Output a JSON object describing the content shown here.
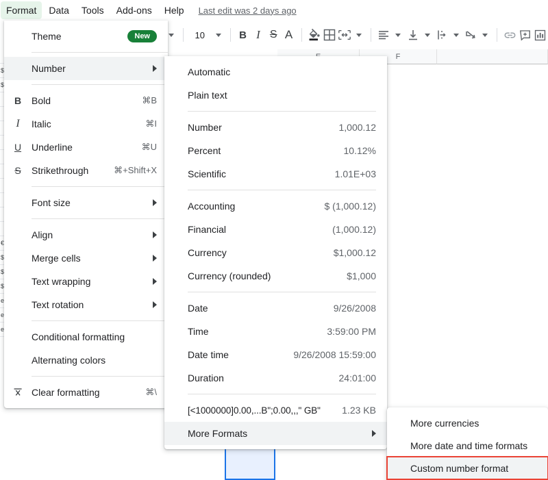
{
  "menubar": {
    "items": [
      {
        "label": "Format",
        "active": true
      },
      {
        "label": "Data",
        "active": false
      },
      {
        "label": "Tools",
        "active": false
      },
      {
        "label": "Add-ons",
        "active": false
      },
      {
        "label": "Help",
        "active": false
      }
    ],
    "last_edit": "Last edit was 2 days ago"
  },
  "toolbar": {
    "font_size": "10",
    "buttons": [
      {
        "name": "bold-button",
        "glyph": "B"
      },
      {
        "name": "italic-button",
        "glyph": "I"
      },
      {
        "name": "strikethrough-button",
        "glyph": "S"
      },
      {
        "name": "text-color-button",
        "glyph": "A"
      },
      {
        "name": "fill-color-icon",
        "glyph": ""
      },
      {
        "name": "borders-icon",
        "glyph": ""
      },
      {
        "name": "merge-cells-icon",
        "glyph": ""
      },
      {
        "name": "horizontal-align-icon",
        "glyph": ""
      },
      {
        "name": "vertical-align-icon",
        "glyph": ""
      },
      {
        "name": "text-wrapping-icon",
        "glyph": ""
      },
      {
        "name": "text-rotation-icon",
        "glyph": ""
      },
      {
        "name": "insert-link-icon",
        "glyph": ""
      },
      {
        "name": "insert-comment-icon",
        "glyph": ""
      },
      {
        "name": "insert-chart-icon",
        "glyph": ""
      }
    ]
  },
  "grid": {
    "column_headers": [
      "E",
      "F",
      ""
    ],
    "left_sliver": [
      "$",
      "$",
      "",
      "",
      "",
      "",
      "",
      "",
      "",
      "",
      "",
      "",
      "",
      "€",
      "$",
      "$",
      "$",
      "e",
      "e",
      "e",
      ""
    ]
  },
  "format_menu": {
    "items": [
      {
        "icon": "",
        "label": "Theme",
        "badge": "New",
        "type": "badge"
      },
      {
        "type": "separator"
      },
      {
        "icon": "",
        "label": "Number",
        "type": "submenu",
        "highlighted": true
      },
      {
        "type": "separator"
      },
      {
        "icon": "B",
        "label": "Bold",
        "accel": "⌘B",
        "type": "accel"
      },
      {
        "icon": "I",
        "label": "Italic",
        "accel": "⌘I",
        "type": "accel"
      },
      {
        "icon": "U",
        "label": "Underline",
        "accel": "⌘U",
        "type": "accel"
      },
      {
        "icon": "S",
        "label": "Strikethrough",
        "accel": "⌘+Shift+X",
        "type": "accel"
      },
      {
        "type": "separator"
      },
      {
        "icon": "",
        "label": "Font size",
        "type": "submenu"
      },
      {
        "type": "separator"
      },
      {
        "icon": "",
        "label": "Align",
        "type": "submenu"
      },
      {
        "icon": "",
        "label": "Merge cells",
        "type": "submenu"
      },
      {
        "icon": "",
        "label": "Text wrapping",
        "type": "submenu"
      },
      {
        "icon": "",
        "label": "Text rotation",
        "type": "submenu"
      },
      {
        "type": "separator"
      },
      {
        "icon": "",
        "label": "Conditional formatting",
        "type": "plain"
      },
      {
        "icon": "",
        "label": "Alternating colors",
        "type": "plain"
      },
      {
        "type": "separator"
      },
      {
        "icon": "clear-formatting",
        "label": "Clear formatting",
        "accel": "⌘\\",
        "type": "accel"
      }
    ]
  },
  "number_menu": {
    "items": [
      {
        "label": "Automatic",
        "value": "",
        "type": "plain"
      },
      {
        "label": "Plain text",
        "value": "",
        "type": "plain"
      },
      {
        "type": "separator"
      },
      {
        "label": "Number",
        "value": "1,000.12",
        "type": "value"
      },
      {
        "label": "Percent",
        "value": "10.12%",
        "type": "value"
      },
      {
        "label": "Scientific",
        "value": "1.01E+03",
        "type": "value"
      },
      {
        "type": "separator"
      },
      {
        "label": "Accounting",
        "value": "$ (1,000.12)",
        "type": "value"
      },
      {
        "label": "Financial",
        "value": "(1,000.12)",
        "type": "value"
      },
      {
        "label": "Currency",
        "value": "$1,000.12",
        "type": "value"
      },
      {
        "label": "Currency (rounded)",
        "value": "$1,000",
        "type": "value"
      },
      {
        "type": "separator"
      },
      {
        "label": "Date",
        "value": "9/26/2008",
        "type": "value"
      },
      {
        "label": "Time",
        "value": "3:59:00 PM",
        "type": "value"
      },
      {
        "label": "Date time",
        "value": "9/26/2008 15:59:00",
        "type": "value"
      },
      {
        "label": "Duration",
        "value": "24:01:00",
        "type": "value"
      },
      {
        "type": "separator"
      },
      {
        "label": "[<1000000]0.00,...B\";0.00,,,\" GB\"",
        "value": "1.23 KB",
        "type": "value",
        "mono": true
      },
      {
        "label": "More Formats",
        "value": "",
        "type": "submenu",
        "highlighted": true
      }
    ]
  },
  "more_formats_menu": {
    "items": [
      {
        "label": "More currencies",
        "highlighted": false
      },
      {
        "label": "More date and time formats",
        "highlighted": false
      },
      {
        "label": "Custom number format",
        "highlighted": true
      }
    ]
  },
  "colors": {
    "accent_green": "#188038",
    "menu_active_bg": "#e6f4ea",
    "highlight_bg": "#f1f3f4",
    "selection_blue": "#1a73e8",
    "selection_fill": "#e8f0fe",
    "annotation_red": "#ea4335"
  }
}
